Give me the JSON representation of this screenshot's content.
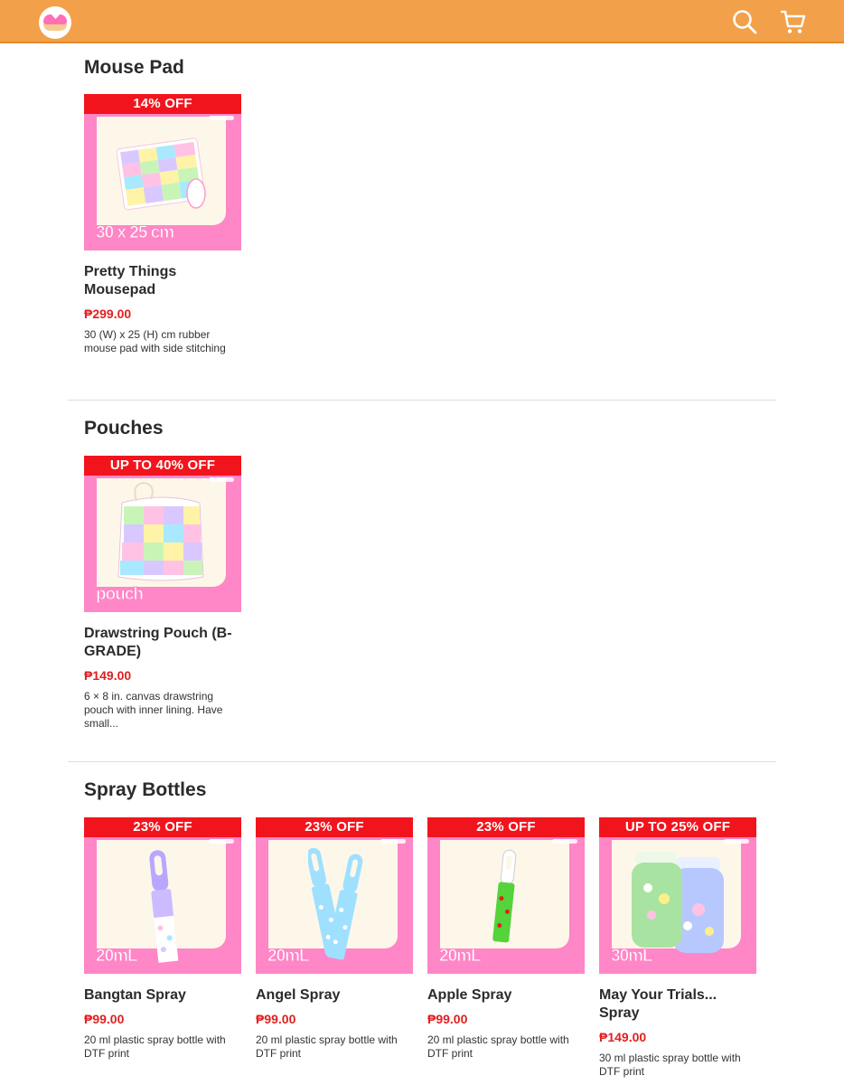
{
  "header": {
    "logo_icon": "donut-logo-icon",
    "search_icon": "search-icon",
    "cart_icon": "cart-icon",
    "bg_color": "#f2a14a"
  },
  "sections": [
    {
      "title": "Mouse Pad",
      "products": [
        {
          "badge": "14% OFF",
          "size_label": "30 x 25 cm",
          "name": "Pretty Things Mousepad",
          "price": "₱299.00",
          "description": "30 (W) x 25 (H) cm rubber mouse pad with side stitching"
        }
      ]
    },
    {
      "title": "Pouches",
      "products": [
        {
          "badge": "UP TO 40% OFF",
          "size_label": "pouch",
          "name": "Drawstring Pouch (B-GRADE)",
          "price": "₱149.00",
          "description": "6 × 8 in. canvas drawstring pouch with inner lining. Have small..."
        }
      ]
    },
    {
      "title": "Spray Bottles",
      "products": [
        {
          "badge": "23% OFF",
          "size_label": "20mL",
          "name": "Bangtan Spray",
          "price": "₱99.00",
          "description": "20 ml plastic spray bottle with DTF print"
        },
        {
          "badge": "23% OFF",
          "size_label": "20mL",
          "name": "Angel Spray",
          "price": "₱99.00",
          "description": "20 ml plastic spray bottle with DTF print"
        },
        {
          "badge": "23% OFF",
          "size_label": "20mL",
          "name": "Apple Spray",
          "price": "₱99.00",
          "description": "20 ml plastic spray bottle with DTF print"
        },
        {
          "badge": "UP TO 25% OFF",
          "size_label": "30mL",
          "name": "May Your Trials... Spray",
          "price": "₱149.00",
          "description": "30 ml plastic spray bottle with DTF print"
        }
      ]
    }
  ],
  "colors": {
    "accent": "#f2a14a",
    "badge": "#f2141d",
    "price": "#e02020",
    "thumb_bg": "#ff86c7"
  }
}
